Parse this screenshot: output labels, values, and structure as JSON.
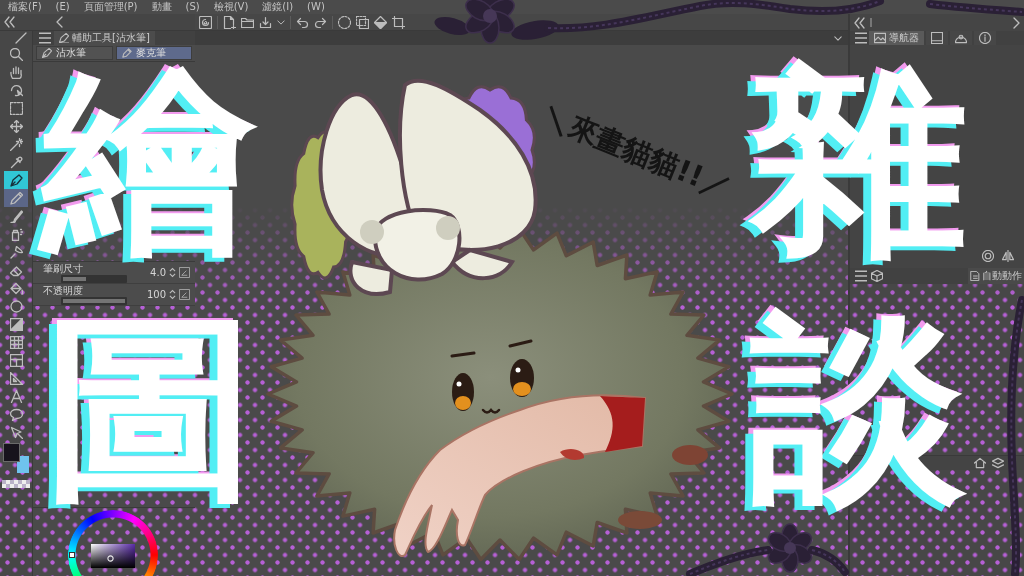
{
  "menu_bar": {
    "items": [
      "檔案(F)",
      "(E)",
      "頁面管理(P)",
      "動畫",
      "(S)",
      "檢視(V)",
      "濾鏡(I)",
      "(W)"
    ]
  },
  "toolbar": {
    "tools": [
      {
        "kind": "zoom",
        "selected": false,
        "hovered": false
      },
      {
        "kind": "hand",
        "selected": false,
        "hovered": false
      },
      {
        "kind": "rotate",
        "selected": false,
        "hovered": false
      },
      {
        "kind": "select",
        "selected": false,
        "hovered": false
      },
      {
        "kind": "move",
        "selected": false,
        "hovered": false
      },
      {
        "kind": "wand",
        "selected": false,
        "hovered": false
      },
      {
        "kind": "eyedropper",
        "selected": false,
        "hovered": false
      },
      {
        "kind": "pen",
        "selected": true,
        "hovered": false
      },
      {
        "kind": "pencil",
        "selected": false,
        "hovered": true
      },
      {
        "kind": "brush",
        "selected": false,
        "hovered": false
      },
      {
        "kind": "airbrush",
        "selected": false,
        "hovered": false
      },
      {
        "kind": "blend",
        "selected": false,
        "hovered": false
      },
      {
        "kind": "eraser",
        "selected": false,
        "hovered": false
      },
      {
        "kind": "fill",
        "selected": false,
        "hovered": false
      },
      {
        "kind": "shape",
        "selected": false,
        "hovered": false
      },
      {
        "kind": "gradient",
        "selected": false,
        "hovered": false
      },
      {
        "kind": "figure",
        "selected": false,
        "hovered": false
      },
      {
        "kind": "frame",
        "selected": false,
        "hovered": false
      },
      {
        "kind": "ruler",
        "selected": false,
        "hovered": false
      },
      {
        "kind": "text",
        "selected": false,
        "hovered": false
      },
      {
        "kind": "balloon",
        "selected": false,
        "hovered": false
      },
      {
        "kind": "correct",
        "selected": false,
        "hovered": false
      }
    ]
  },
  "color_swatches": [
    {
      "color": "#17131c"
    },
    {
      "color": "#6fc3ee"
    }
  ],
  "sub_tool_panel": {
    "tab": "輔助工具[沾水筆]",
    "tools": [
      {
        "label": "沾水筆",
        "selected": false
      },
      {
        "label": "麥克筆",
        "selected": true
      }
    ]
  },
  "tool_property": {
    "rows": [
      {
        "label": "筆刷尺寸",
        "value": "4.0",
        "level": 0.37
      },
      {
        "label": "不透明度",
        "value": "100",
        "level": 1
      }
    ]
  },
  "navigator_panel": {
    "tabs": [
      {
        "kind": "navigator",
        "label": "導航器",
        "selected": true
      },
      {
        "kind": "subview",
        "selected": false
      },
      {
        "kind": "dome",
        "selected": false
      },
      {
        "kind": "info",
        "selected": false
      }
    ]
  },
  "layer_panel": {
    "tab": "自動動作"
  },
  "headlines": [
    "繪圖",
    "雜談"
  ],
  "speech_text": "＼來畫貓貓!!／"
}
